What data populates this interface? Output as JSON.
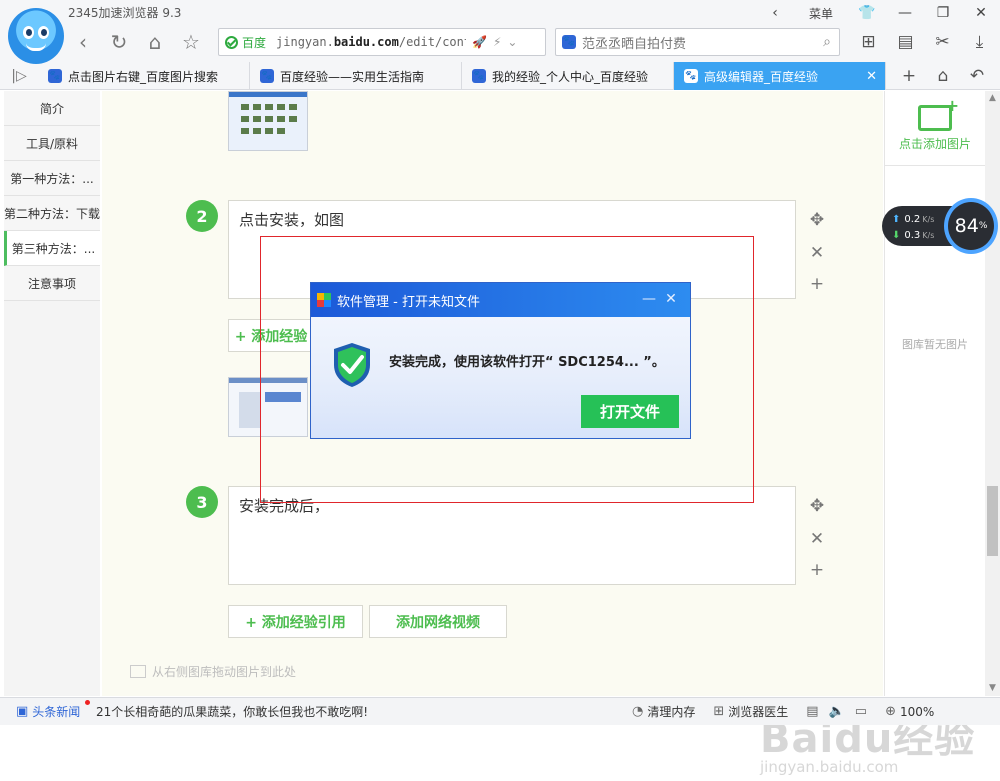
{
  "browser": {
    "app_title": "2345加速浏览器 9.3",
    "menu_label": "菜单",
    "address": {
      "site": "百度",
      "url_prefix": "jingyan.",
      "url_domain": "baidu.com",
      "url_rest": "/edit/conte"
    },
    "search_placeholder": "范丞丞晒自拍付费",
    "tabs": [
      {
        "label": "点击图片右键_百度图片搜索"
      },
      {
        "label": "百度经验——实用生活指南"
      },
      {
        "label": "我的经验_个人中心_百度经验"
      },
      {
        "label": "高级编辑器_百度经验",
        "active": true
      }
    ]
  },
  "sidebar": {
    "items": [
      {
        "label": "简介"
      },
      {
        "label": "工具/原料"
      },
      {
        "label": "第一种方法：..."
      },
      {
        "label": "第二种方法：下载"
      },
      {
        "label": "第三种方法：...",
        "active": true
      },
      {
        "label": "注意事项"
      }
    ]
  },
  "editor": {
    "steps": [
      {
        "number": "2",
        "text": "点击安装，如图"
      },
      {
        "number": "3",
        "text": "安装完成后，"
      }
    ],
    "add_quote_label": "+ 添加经验引用",
    "add_quote_partial": "+ 添加经验",
    "add_video_label": "添加网络视频",
    "drop_hint": "从右侧图库拖动图片到此处"
  },
  "right_panel": {
    "add_image_label": "点击添加图片",
    "empty_library": "图库暂无图片"
  },
  "speed_widget": {
    "up": "0.2",
    "down": "0.3",
    "unit": "K/s",
    "percent": "84",
    "percent_sign": "%"
  },
  "dialog": {
    "title": "软件管理 - 打开未知文件",
    "message": "安装完成，使用该软件打开“ SDC1254... ”。",
    "open_button": "打开文件"
  },
  "status_bar": {
    "news_label": "头条新闻",
    "ticker": "21个长相奇葩的瓜果蔬菜，你敢长但我也不敢吃啊!",
    "clean_memory": "清理内存",
    "browser_doctor": "浏览器医生",
    "zoom": "100%"
  },
  "watermark": {
    "brand": "Baidu经验",
    "url": "jingyan.baidu.com"
  },
  "colors": {
    "accent_green": "#4dbd4f",
    "tab_active": "#3aa3f2",
    "dialog_title": "#1c59d8",
    "selection_red": "#e0262c"
  }
}
